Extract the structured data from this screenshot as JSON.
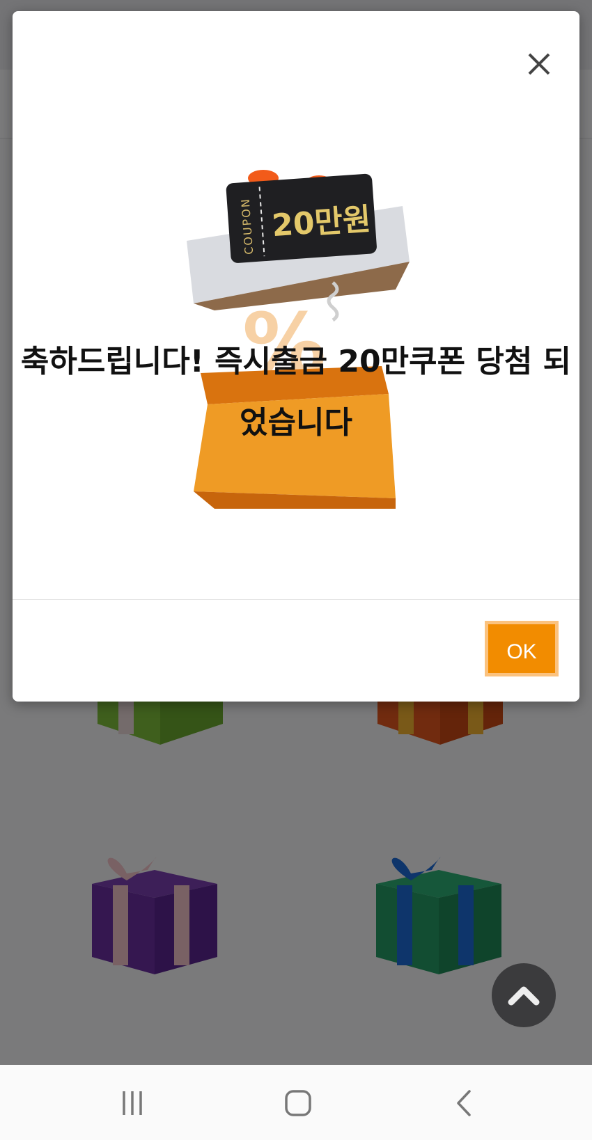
{
  "modal": {
    "message": "축하드립니다! 즉시출금 20만쿠폰 당첨 되었습니다",
    "ok_label": "OK",
    "coupon": {
      "label": "COUPON",
      "amount": "20만원"
    }
  },
  "colors": {
    "accent": "#f28c00",
    "overlay": "#808080"
  },
  "icons": {
    "close": "close-icon",
    "scroll_top": "chevron-up-icon",
    "nav_recent": "recent-apps-icon",
    "nav_home": "home-icon",
    "nav_back": "back-icon"
  }
}
